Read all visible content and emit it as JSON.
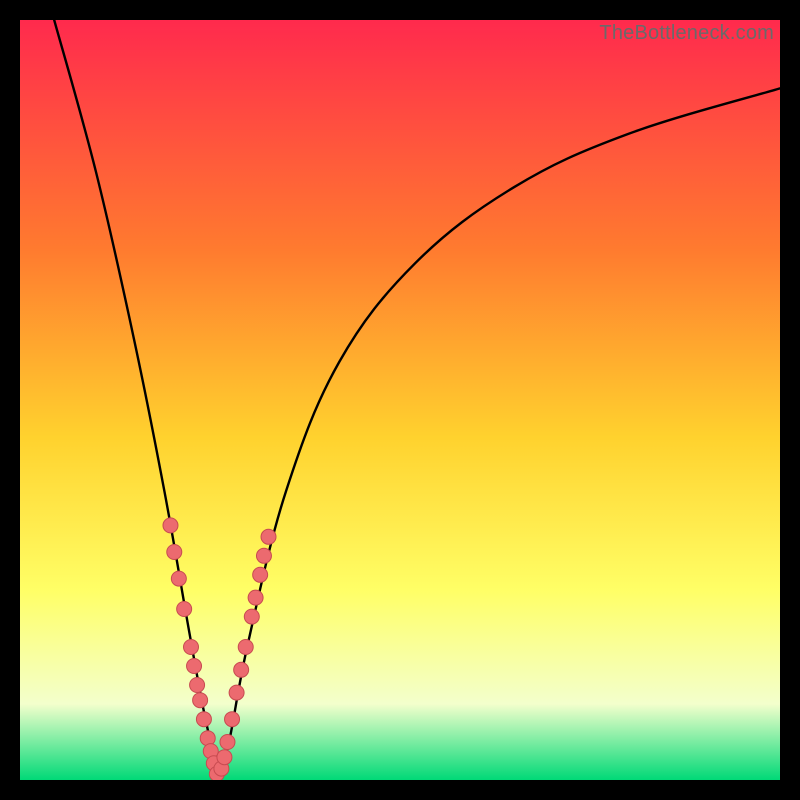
{
  "watermark": "TheBottleneck.com",
  "colors": {
    "gradient_top": "#ff2a4d",
    "gradient_mid1": "#ff7a2f",
    "gradient_mid2": "#ffd22e",
    "gradient_mid3": "#ffff66",
    "gradient_mid4": "#f3ffcc",
    "gradient_bottom": "#00d977",
    "curve": "#000000",
    "marker_fill": "#ec6a6f",
    "marker_stroke": "#c74b50"
  },
  "chart_data": {
    "type": "line",
    "title": "",
    "xlabel": "",
    "ylabel": "",
    "x_range": [
      0,
      100
    ],
    "y_range": [
      0,
      100
    ],
    "notch_x": 26,
    "left_curve": [
      {
        "x": 4.5,
        "y": 100
      },
      {
        "x": 10,
        "y": 80
      },
      {
        "x": 15,
        "y": 58
      },
      {
        "x": 19,
        "y": 38
      },
      {
        "x": 22,
        "y": 21
      },
      {
        "x": 24,
        "y": 10
      },
      {
        "x": 25.5,
        "y": 3
      },
      {
        "x": 26,
        "y": 0
      }
    ],
    "right_curve": [
      {
        "x": 26,
        "y": 0
      },
      {
        "x": 27.5,
        "y": 5
      },
      {
        "x": 30,
        "y": 18
      },
      {
        "x": 35,
        "y": 38
      },
      {
        "x": 42,
        "y": 55
      },
      {
        "x": 52,
        "y": 68
      },
      {
        "x": 65,
        "y": 78
      },
      {
        "x": 80,
        "y": 85
      },
      {
        "x": 100,
        "y": 91
      }
    ],
    "markers_left": [
      {
        "x": 19.8,
        "y": 33.5
      },
      {
        "x": 20.3,
        "y": 30.0
      },
      {
        "x": 20.9,
        "y": 26.5
      },
      {
        "x": 21.6,
        "y": 22.5
      },
      {
        "x": 22.5,
        "y": 17.5
      },
      {
        "x": 22.9,
        "y": 15.0
      },
      {
        "x": 23.3,
        "y": 12.5
      },
      {
        "x": 23.7,
        "y": 10.5
      },
      {
        "x": 24.2,
        "y": 8.0
      },
      {
        "x": 24.7,
        "y": 5.5
      },
      {
        "x": 25.1,
        "y": 3.8
      },
      {
        "x": 25.5,
        "y": 2.2
      },
      {
        "x": 25.9,
        "y": 0.8
      }
    ],
    "markers_right": [
      {
        "x": 26.5,
        "y": 1.5
      },
      {
        "x": 26.9,
        "y": 3.0
      },
      {
        "x": 27.3,
        "y": 5.0
      },
      {
        "x": 27.9,
        "y": 8.0
      },
      {
        "x": 28.5,
        "y": 11.5
      },
      {
        "x": 29.1,
        "y": 14.5
      },
      {
        "x": 29.7,
        "y": 17.5
      },
      {
        "x": 30.5,
        "y": 21.5
      },
      {
        "x": 31.0,
        "y": 24.0
      },
      {
        "x": 31.6,
        "y": 27.0
      },
      {
        "x": 32.1,
        "y": 29.5
      },
      {
        "x": 32.7,
        "y": 32.0
      }
    ]
  }
}
